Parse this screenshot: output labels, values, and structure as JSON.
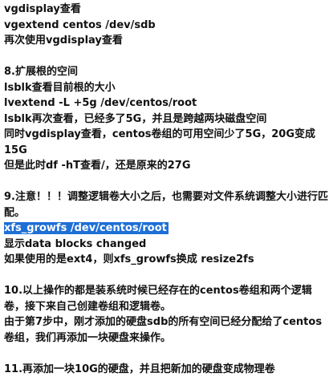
{
  "lines": {
    "l1": "vgdisplay查看",
    "l2": "vgextend centos /dev/sdb",
    "l3": "再次使用vgdisplay查看",
    "l4": "8.扩展根的空间",
    "l5": "lsblk查看目前根的大小",
    "l6": "lvextend -L +5g /dev/centos/root",
    "l7": "lsblk再次查看，已经多了5G，并且是跨越两块磁盘空间",
    "l8": "同时vgdisplay查看，centos卷组的可用空间少了5G，20G变成15G",
    "l9": "但是此时df -hT查看/，还是原来的27G",
    "l10": "9.注意！！！调整逻辑卷大小之后，也需要对文件系统调整大小进行匹配。",
    "l11": "xfs_growfs /dev/centos/root",
    "l12": "显示data blocks changed",
    "l13": "如果使用的是ext4，则xfs_growfs换成 resize2fs",
    "l14": "10.以上操作的都是装系统时候已经存在的centos卷组和两个逻辑卷，接下来自己创建卷组和逻辑卷。",
    "l15": "由于第7步中，刚才添加的硬盘sdb的所有空间已经分配给了centos卷组，我们再添加一块硬盘来操作。",
    "l16": "11.再添加一块10G的硬盘，并且把新加的硬盘变成物理卷"
  },
  "colors": {
    "text": "#111111",
    "highlight": "#1e6fd6",
    "highlight_text": "#ffffff",
    "background": "#ffffff"
  }
}
